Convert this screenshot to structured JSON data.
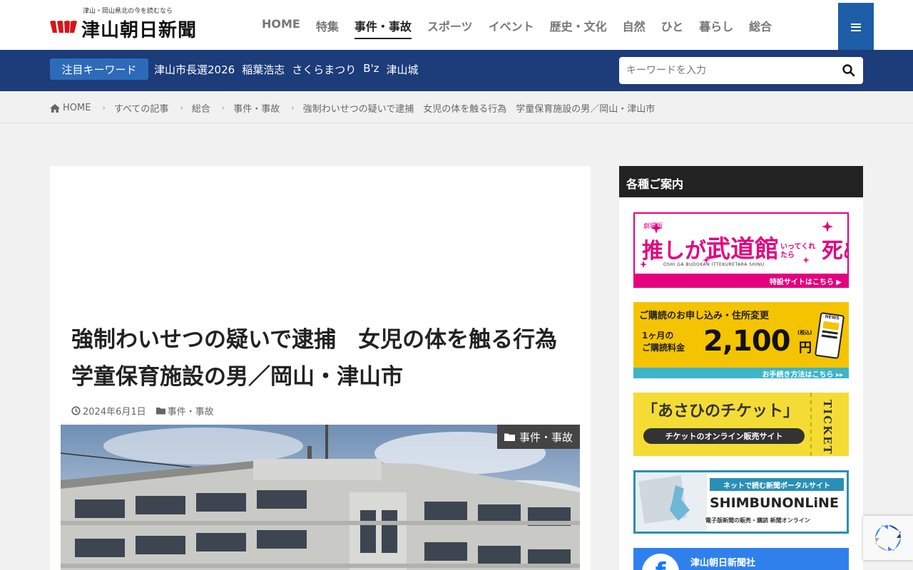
{
  "header": {
    "tagline": "津山・岡山県北の今を読むなら",
    "site_name": "津山朝日新聞",
    "nav": [
      {
        "label": "HOME",
        "active": false
      },
      {
        "label": "特集",
        "active": false
      },
      {
        "label": "事件・事故",
        "active": true
      },
      {
        "label": "スポーツ",
        "active": false
      },
      {
        "label": "イベント",
        "active": false
      },
      {
        "label": "歴史・文化",
        "active": false
      },
      {
        "label": "自然",
        "active": false
      },
      {
        "label": "ひと",
        "active": false
      },
      {
        "label": "暮らし",
        "active": false
      },
      {
        "label": "総合",
        "active": false
      }
    ],
    "menu_icon": "hamburger-icon"
  },
  "keywords": {
    "label": "注目キーワード",
    "items": [
      "津山市長選2026",
      "稲葉浩志",
      "さくらまつり",
      "B'z",
      "津山城"
    ],
    "search_placeholder": "キーワードを入力"
  },
  "breadcrumb": [
    "HOME",
    "すべての記事",
    "総合",
    "事件・事故",
    "強制わいせつの疑いで逮捕　女児の体を触る行為　学童保育施設の男／岡山・津山市"
  ],
  "article": {
    "title": "強制わいせつの疑いで逮捕　女児の体を触る行為　学童保育施設の男／岡山・津山市",
    "date": "2024年6月1日",
    "category": "事件・事故",
    "badge": "事件・事故"
  },
  "sidebar": {
    "heading": "各種ご案内",
    "banner1": {
      "small": "劇場版",
      "title_a": "推しが",
      "title_b": "武道館",
      "title_c": "いってくれたら",
      "title_d": "死ぬ",
      "romaji": "OSHI GA BUDOKAN ITTEKURETARA SHINU",
      "link": "特設サイトはこちら"
    },
    "banner2": {
      "head": "ご購読のお申し込み・住所変更",
      "line1": "1ヶ月の",
      "line2": "ご購読料金",
      "price": "2,100",
      "unit": "円",
      "tax": "(税込)",
      "link": "お手続き方法はこちら",
      "news": "NEWS"
    },
    "banner3": {
      "title": "「あさひのチケット」",
      "sub": "チケットのオンライン販売サイト",
      "side": "TICKET"
    },
    "banner4": {
      "tag": "ネットで読む新聞ポータルサイト",
      "brand": "SHIMBUNONLiNE",
      "sub": "電子版新聞の販売・購読 新聞オンライン"
    },
    "banner5": {
      "name": "津山朝日新聞社"
    }
  },
  "colors": {
    "brand_red": "#d7141a",
    "nav_blue": "#1c3c7a",
    "accent_blue": "#2d6bb8",
    "menu_blue": "#1e5ea8"
  }
}
